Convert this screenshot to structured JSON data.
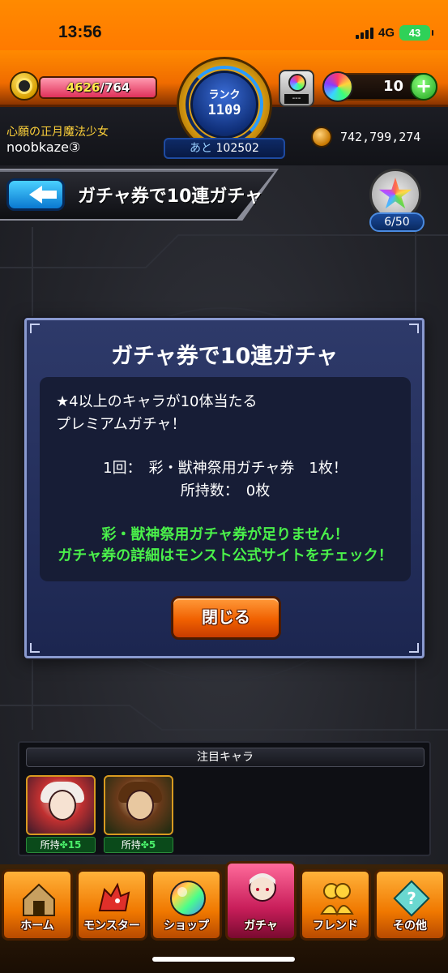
{
  "status_bar": {
    "time": "13:56",
    "network": "4G",
    "battery": "43"
  },
  "hud": {
    "stamina_current": "4626",
    "stamina_max": "/764",
    "stamina_fill_fraction": 1.0,
    "rank_label": "ランク",
    "rank_value": "1109",
    "rank_next_label": "あと",
    "rank_next_value": "102502",
    "orb_slot_text": "---",
    "orb_count": "10",
    "orb_add_label": "+",
    "player_title": "心願の正月魔法少女",
    "player_name": "noobkaze③",
    "gold_amount": "742,799,274"
  },
  "header": {
    "page_title": "ガチャ券で10連ガチャ",
    "medal_count": "6/50"
  },
  "dialog": {
    "title": "ガチャ券で10連ガチャ",
    "lines": [
      "★4以上のキャラが10体当たる",
      "プレミアムガチャ！",
      "1回：　彩・獣神祭用ガチャ券　1枚！",
      "所持数：　0枚"
    ],
    "warning_lines": [
      "彩・獣神祭用ガチャ券が足りません！",
      "ガチャ券の詳細はモンスト公式サイトをチェック！"
    ],
    "close_label": "閉じる"
  },
  "featured": {
    "header": "注目キャラ",
    "characters": [
      {
        "owned_label": "所持",
        "owned_count": "15"
      },
      {
        "owned_label": "所持",
        "owned_count": "5"
      }
    ],
    "clover": "✤"
  },
  "nav": {
    "items": [
      {
        "label": "ホーム",
        "icon": "home-icon"
      },
      {
        "label": "モンスター",
        "icon": "monster-icon"
      },
      {
        "label": "ショップ",
        "icon": "shop-icon"
      },
      {
        "label": "ガチャ",
        "icon": "gacha-icon"
      },
      {
        "label": "フレンド",
        "icon": "friend-icon"
      },
      {
        "label": "その他",
        "icon": "other-icon"
      }
    ],
    "active_index": 3
  },
  "colors": {
    "accent_orange": "#f07800",
    "warning_green": "#4af04a",
    "dialog_blue": "#2e3a6a"
  }
}
